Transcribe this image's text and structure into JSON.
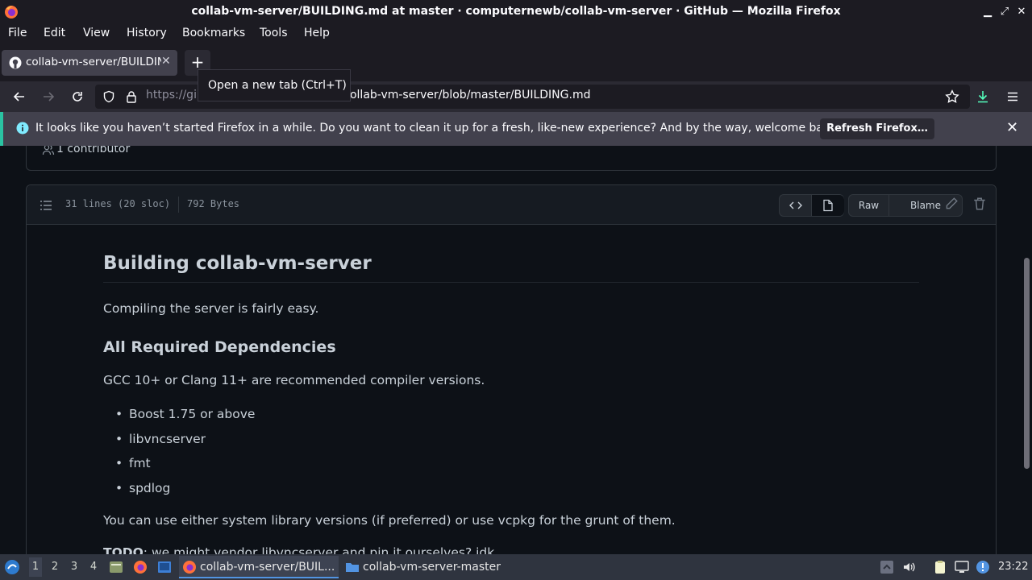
{
  "window": {
    "title": "collab-vm-server/BUILDING.md at master · computernewb/collab-vm-server · GitHub — Mozilla Firefox",
    "min": "▁",
    "max": "⤢",
    "close": "✕"
  },
  "menu": [
    "File",
    "Edit",
    "View",
    "History",
    "Bookmarks",
    "Tools",
    "Help"
  ],
  "tab": {
    "label": "collab-vm-server/BUILDING.md",
    "close": "✕"
  },
  "newtab": {
    "glyph": "+",
    "tooltip": "Open a new tab (Ctrl+T)"
  },
  "nav": {
    "url_prefix": "https://gi",
    "url_rest": "ollab-vm-server/blob/master/BUILDING.md"
  },
  "notification": {
    "message": "It looks like you haven’t started Firefox in a while. Do you want to clean it up for a fresh, like-new experience? And by the way, welcome back!",
    "button": "Refresh Firefox…",
    "close": "✕"
  },
  "page": {
    "contributors": "1 contributor",
    "file_lines": "31 lines (20 sloc)",
    "file_size": "792 Bytes",
    "raw": "Raw",
    "blame": "Blame"
  },
  "markdown": {
    "h1": "Building collab-vm-server",
    "p1": "Compiling the server is fairly easy.",
    "h2": "All Required Dependencies",
    "p2": "GCC 10+ or Clang 11+ are recommended compiler versions.",
    "deps": [
      "Boost 1.75 or above",
      "libvncserver",
      "fmt",
      "spdlog"
    ],
    "p3": "You can use either system library versions (if preferred) or use vcpkg for the grunt of them.",
    "todo_bold": "TODO",
    "todo_rest": ": we might vendor libvncserver and pin it ourselves? idk"
  },
  "taskbar": {
    "workspaces": [
      "1",
      "2",
      "3",
      "4"
    ],
    "tasks": [
      "collab-vm-server/BUIL...",
      "collab-vm-server-master"
    ],
    "clock": "23:22"
  },
  "colors": {
    "accent": "#0060df",
    "notification_stripe": "#2ac3a2",
    "page_bg": "#0d1117"
  }
}
